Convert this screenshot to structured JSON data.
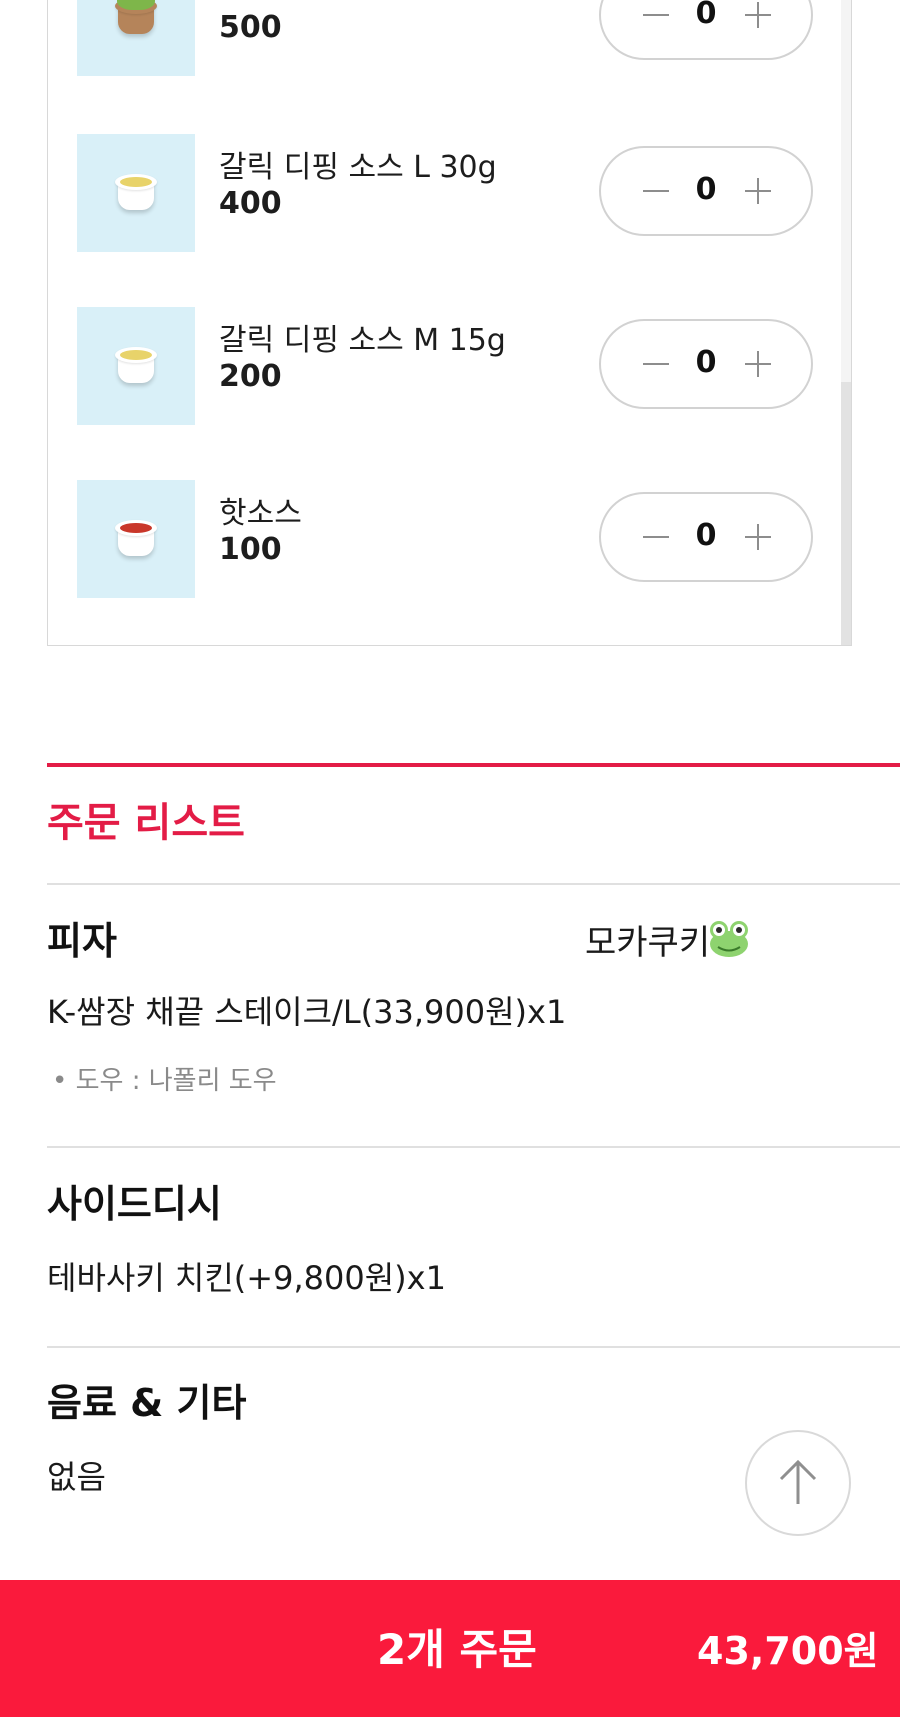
{
  "side_items": [
    {
      "name": "",
      "price": "500",
      "qty": "0",
      "image": "salad-cup"
    },
    {
      "name": "갈릭 디핑 소스 L 30g",
      "price": "400",
      "qty": "0",
      "image": "garlic-sauce-cup"
    },
    {
      "name": "갈릭 디핑 소스 M 15g",
      "price": "200",
      "qty": "0",
      "image": "garlic-sauce-cup"
    },
    {
      "name": "핫소스",
      "price": "100",
      "qty": "0",
      "image": "hot-sauce-cup"
    }
  ],
  "order_list": {
    "title": "주문 리스트",
    "pizza": {
      "title": "피자",
      "nickname": "모카쿠키",
      "line": "K-쌈장 채끝 스테이크/L(33,900원)x1",
      "option": "• 도우 : 나폴리 도우"
    },
    "side": {
      "title": "사이드디시",
      "line": "테바사키 치킨(+9,800원)x1"
    },
    "drink": {
      "title": "음료 & 기타",
      "line": "없음"
    }
  },
  "bottom_bar": {
    "order_label": "2개 주문",
    "total": "43,700원"
  },
  "colors": {
    "accent": "#e31c46",
    "bar": "#fa1a3c",
    "thumb_bg": "#d9f0f8"
  },
  "icons": {
    "minus": "minus-icon",
    "plus": "plus-icon",
    "scroll_top": "arrow-up-icon",
    "frog": "frog-emoji-icon"
  }
}
